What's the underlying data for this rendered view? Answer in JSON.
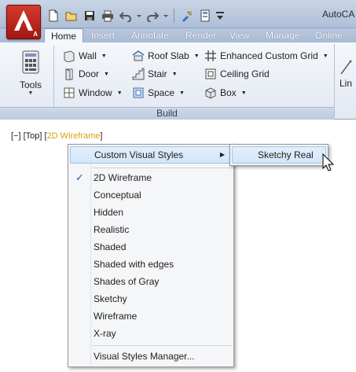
{
  "app": {
    "title": "AutoCA"
  },
  "tabs": [
    {
      "label": "Home",
      "active": true
    },
    {
      "label": "Insert"
    },
    {
      "label": "Annotate"
    },
    {
      "label": "Render"
    },
    {
      "label": "View"
    },
    {
      "label": "Manage"
    },
    {
      "label": "Online"
    }
  ],
  "ribbon": {
    "tools_label": "Tools",
    "build_label": "Build",
    "line_label": "Lin",
    "buttons": {
      "wall": "Wall",
      "door": "Door",
      "window": "Window",
      "roof_slab": "Roof Slab",
      "stair": "Stair",
      "space": "Space",
      "enhanced_grid": "Enhanced Custom Grid",
      "ceiling_grid": "Ceiling Grid",
      "box": "Box"
    }
  },
  "viewport": {
    "label_prefix": "[−] [Top] [",
    "visual_style": "2D Wireframe",
    "label_suffix": "]"
  },
  "menu": {
    "custom_visual_styles": "Custom Visual Styles",
    "items": [
      {
        "label": "2D Wireframe",
        "checked": true
      },
      {
        "label": "Conceptual"
      },
      {
        "label": "Hidden"
      },
      {
        "label": "Realistic"
      },
      {
        "label": "Shaded"
      },
      {
        "label": "Shaded with edges"
      },
      {
        "label": "Shades of Gray"
      },
      {
        "label": "Sketchy"
      },
      {
        "label": "Wireframe"
      },
      {
        "label": "X-ray"
      }
    ],
    "manager": "Visual Styles Manager..."
  },
  "submenu": {
    "item": "Sketchy Real"
  },
  "colors": {
    "accent": "#d4a510",
    "check": "#1e5ba8",
    "app_button": "#c42b22"
  }
}
